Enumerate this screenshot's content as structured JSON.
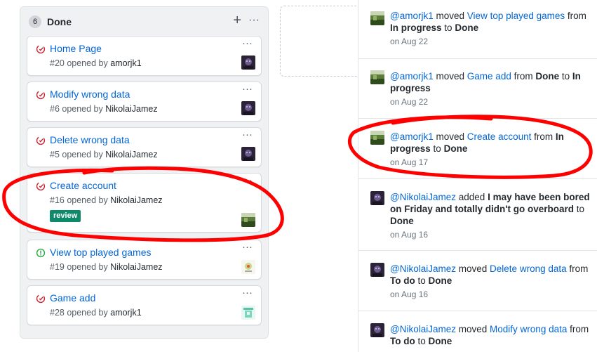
{
  "column": {
    "count": "6",
    "title": "Done",
    "add_symbol": "+",
    "more_symbol": "···"
  },
  "cards": [
    {
      "title": "Home Page",
      "meta": "#20 opened by",
      "user": "amorjk1",
      "state": "closed",
      "avatar": "dark-avatar"
    },
    {
      "title": "Modify wrong data",
      "meta": "#6 opened by",
      "user": "NikolaiJamez",
      "state": "closed",
      "avatar": "dark-avatar"
    },
    {
      "title": "Delete wrong data",
      "meta": "#5 opened by",
      "user": "NikolaiJamez",
      "state": "closed",
      "avatar": "dark-avatar"
    },
    {
      "title": "Create account",
      "meta": "#16 opened by",
      "user": "NikolaiJamez",
      "state": "closed",
      "label": "review",
      "avatar": "green-avatar"
    },
    {
      "title": "View top played games",
      "meta": "#19 opened by",
      "user": "NikolaiJamez",
      "state": "open",
      "avatar": "ball-avatar"
    },
    {
      "title": "Game add",
      "meta": "#28 opened by",
      "user": "amorjk1",
      "state": "closed",
      "avatar": "teal-avatar"
    }
  ],
  "activity": [
    {
      "actor": "@amorjk1",
      "verb": "moved",
      "item": "View top played games",
      "from_word": "from",
      "from": "In progress",
      "to_word": "to",
      "to": "Done",
      "date": "on Aug 22",
      "avatar": "green-avatar"
    },
    {
      "actor": "@amorjk1",
      "verb": "moved",
      "item": "Game add",
      "from_word": "from",
      "from": "Done",
      "to_word": "to",
      "to": "In progress",
      "date": "on Aug 22",
      "avatar": "green-avatar"
    },
    {
      "actor": "@amorjk1",
      "verb": "moved",
      "item": "Create account",
      "from_word": "from",
      "from": "In progress",
      "to_word": "to",
      "to": "Done",
      "date": "on Aug 17",
      "avatar": "green-avatar"
    },
    {
      "actor": "@NikolaiJamez",
      "verb": "added",
      "item": "I may have been bored on Friday and totally didn't go overboard",
      "to_word": "to",
      "to": "Done",
      "date": "on Aug 16",
      "avatar": "dark-avatar"
    },
    {
      "actor": "@NikolaiJamez",
      "verb": "moved",
      "item": "Delete wrong data",
      "from_word": "from",
      "from": "To do",
      "to_word": "to",
      "to": "Done",
      "date": "on Aug 16",
      "avatar": "dark-avatar"
    },
    {
      "actor": "@NikolaiJamez",
      "verb": "moved",
      "item": "Modify wrong data",
      "from_word": "from",
      "from": "To do",
      "to_word": "to",
      "to": "Done",
      "date": "",
      "avatar": "dark-avatar"
    }
  ],
  "colors": {
    "link": "#0366d6",
    "closed_icon": "#cb2431",
    "open_icon": "#28a745",
    "label_review": "#0e8a6b",
    "annotation": "#ff0000"
  }
}
